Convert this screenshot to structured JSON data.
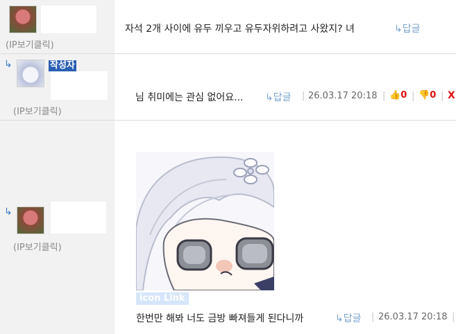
{
  "comments": [
    {
      "ip_label": "(IP보기클릭)",
      "text": "자석 2개 사이에 유두 끼우고 유두자위하려고 사왔지? 녀",
      "reply_label": "답글"
    },
    {
      "author_badge": "작성자",
      "ip_label": "(IP보기클릭)",
      "text": "님 취미에는 관심 없어요...",
      "reply_label": "답글",
      "date": "26.03.17 20:18",
      "upvotes": "0",
      "downvotes": "0",
      "delete_label": "X"
    },
    {
      "ip_label": "(IP보기클릭)",
      "sticker_label": "icon Link",
      "text": "한번만 해봐 너도 금방 빠져들게 된다니까",
      "reply_label": "답글",
      "date": "26.03.17 20:18"
    }
  ],
  "colors": {
    "accent": "#3a78c9",
    "badge": "#2a5fb3",
    "vote_count": "#dd1111",
    "left_panel": "#f2f2f2"
  },
  "icons": [
    "reply-arrow-icon",
    "thumbs-up-icon",
    "thumbs-down-icon",
    "avatar-image"
  ]
}
